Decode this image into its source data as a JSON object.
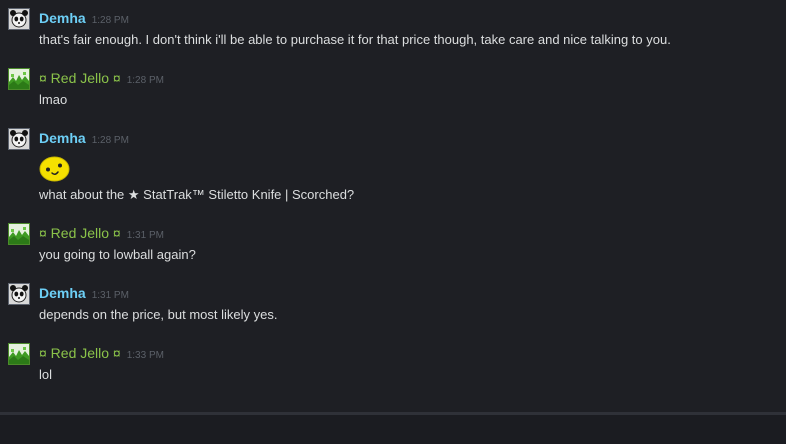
{
  "messages": [
    {
      "author": "Demha",
      "time": "1:28 PM",
      "text": "that's fair enough. I don't think i'll be able to purchase it for that price though, take care and nice talking to you."
    },
    {
      "author": "¤ Red Jello ¤",
      "time": "1:28 PM",
      "text": "lmao"
    },
    {
      "author": "Demha",
      "time": "1:28 PM",
      "emoticon": "yellow-smiley-emoticon",
      "text": "what about the ★ StatTrak™ Stiletto Knife | Scorched?"
    },
    {
      "author": "¤ Red Jello ¤",
      "time": "1:31 PM",
      "text": "you going to lowball again?"
    },
    {
      "author": "Demha",
      "time": "1:31 PM",
      "text": "depends on the price, but most likely yes."
    },
    {
      "author": "¤ Red Jello ¤",
      "time": "1:33 PM",
      "text": "lol"
    }
  ],
  "colors": {
    "background": "#1e1f24",
    "self_name": "#6dcff6",
    "friend_name": "#8bc34a",
    "message_text": "#dcdedf",
    "timestamp": "#5b6068",
    "emoticon": "#f5e000"
  }
}
